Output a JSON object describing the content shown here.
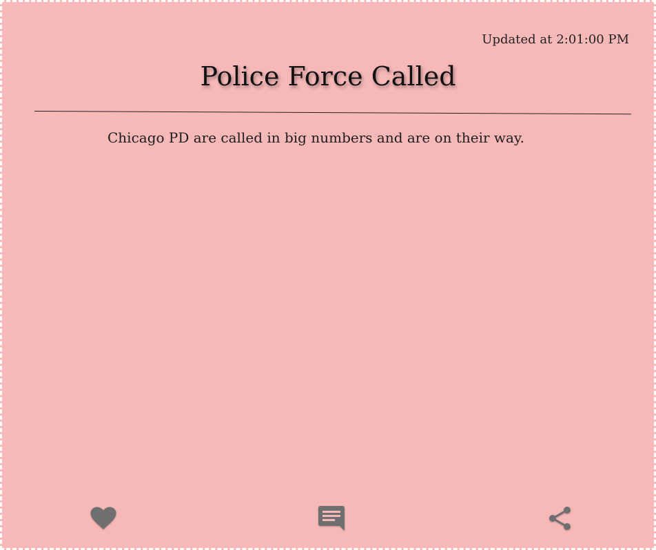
{
  "post": {
    "updated_prefix": "Updated at",
    "updated_time": "2:01:00 PM",
    "title": "Police Force Called",
    "body": "Chicago PD are called in big numbers and are on their way."
  },
  "actions": [
    {
      "icon": "heart-icon",
      "name": "like"
    },
    {
      "icon": "comment-icon",
      "name": "comment"
    },
    {
      "icon": "share-icon",
      "name": "share"
    }
  ],
  "colors": {
    "background": "#f7b8b8",
    "icon": "#6f6f6f",
    "text": "#1a1a1a"
  }
}
